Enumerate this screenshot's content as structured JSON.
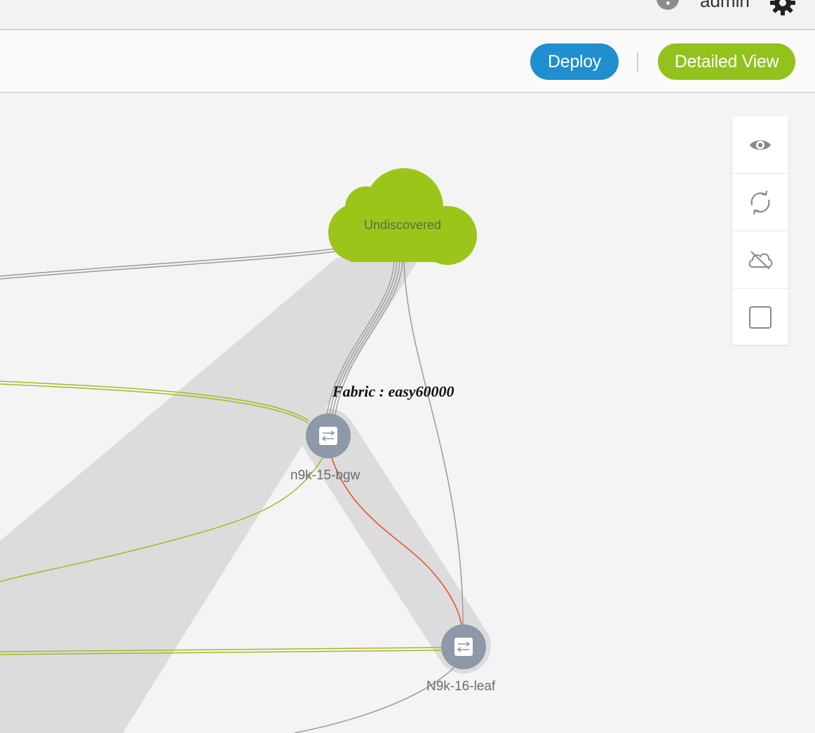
{
  "header": {
    "user": "admin",
    "icons": [
      "help-icon",
      "gear-icon"
    ]
  },
  "toolbar": {
    "deploy_label": "Deploy",
    "detailed_view_label": "Detailed View",
    "colors": {
      "deploy": "#1f8fcf",
      "detailed_view": "#92c21b"
    }
  },
  "topology": {
    "cloud": {
      "label": "Undiscovered",
      "color": "#9cc51a"
    },
    "fabric_label": "Fabric : easy60000",
    "nodes": [
      {
        "name": "n9k-15-bgw",
        "icon": "switch-icon"
      },
      {
        "name": "N9k-16-leaf",
        "icon": "switch-icon"
      }
    ],
    "link_colors": {
      "green": "#a8b823",
      "gray": "#9a9a9a",
      "red": "#e8532a"
    }
  },
  "side_panel": {
    "tools": [
      "eye-icon",
      "refresh-icon",
      "cloud-off-icon",
      "checkbox-icon"
    ]
  }
}
